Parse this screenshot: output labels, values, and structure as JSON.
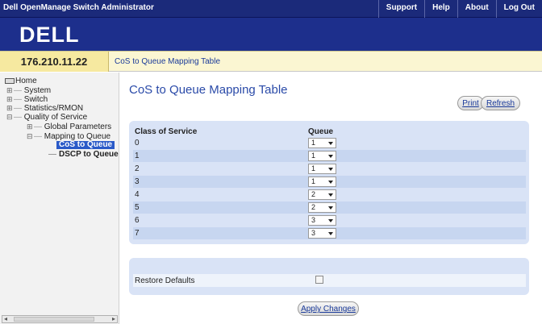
{
  "app": {
    "title": "Dell OpenManage Switch Administrator",
    "nav": [
      "Support",
      "Help",
      "About",
      "Log Out"
    ],
    "logo": "DELL"
  },
  "ipbar": {
    "ip": "176.210.11.22",
    "breadcrumb": "CoS to Queue Mapping Table"
  },
  "tree": {
    "home": "Home",
    "system": "System",
    "switch": "Switch",
    "stats": "Statistics/RMON",
    "qos": "Quality of Service",
    "global": "Global Parameters",
    "mapping": "Mapping to Queue",
    "cos": "CoS to Queue",
    "dscp": "DSCP to Queue"
  },
  "page": {
    "title": "CoS to Queue Mapping Table",
    "print_label": "Print",
    "refresh_label": "Refresh",
    "apply_label": "Apply Changes"
  },
  "table": {
    "col_class": "Class of Service",
    "col_queue": "Queue",
    "rows": [
      {
        "cos": "0",
        "queue": "1"
      },
      {
        "cos": "1",
        "queue": "1"
      },
      {
        "cos": "2",
        "queue": "1"
      },
      {
        "cos": "3",
        "queue": "1"
      },
      {
        "cos": "4",
        "queue": "2"
      },
      {
        "cos": "5",
        "queue": "2"
      },
      {
        "cos": "6",
        "queue": "3"
      },
      {
        "cos": "7",
        "queue": "3"
      }
    ]
  },
  "restore": {
    "label": "Restore Defaults",
    "checked": false
  },
  "colors": {
    "header_bg": "#1b2a7a",
    "banner_bg": "#1d2f8c",
    "panel_bg": "#d9e3f6",
    "title_color": "#2a4aa8",
    "selected_bg": "#2a5ac8"
  }
}
